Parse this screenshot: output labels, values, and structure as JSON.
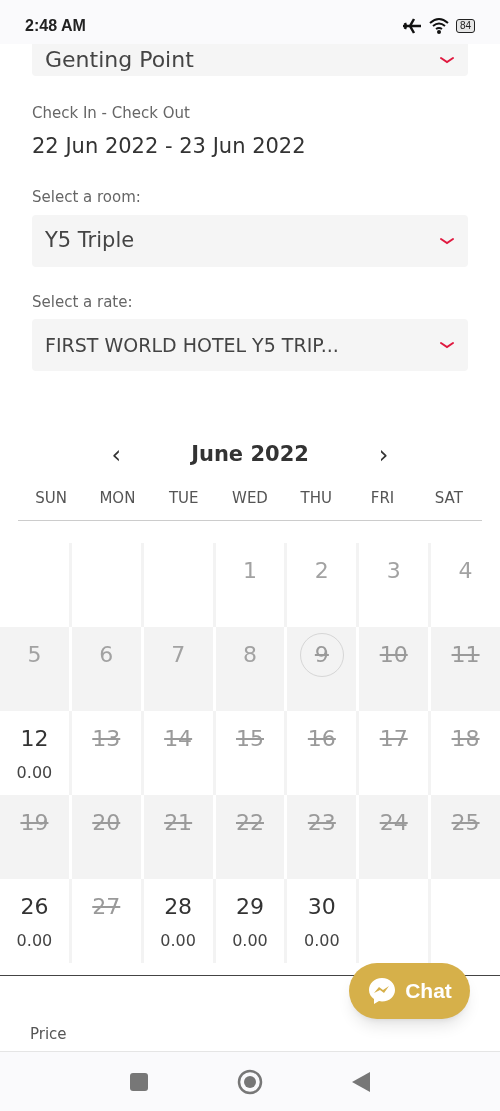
{
  "status_bar": {
    "time": "2:48 AM",
    "battery": "84"
  },
  "property_select": {
    "value": "Genting Point"
  },
  "dates": {
    "label": "Check In - Check Out",
    "value": "22 Jun 2022 - 23 Jun 2022"
  },
  "room": {
    "label": "Select a room:",
    "value": "Y5 Triple"
  },
  "rate": {
    "label": "Select a rate:",
    "value": "FIRST WORLD HOTEL Y5 TRIP..."
  },
  "calendar": {
    "prev": "‹",
    "month": "June 2022",
    "next": "›",
    "weekdays": [
      "SUN",
      "MON",
      "TUE",
      "WED",
      "THU",
      "FRI",
      "SAT"
    ],
    "weeks": [
      {
        "shaded": false,
        "days": [
          {
            "kind": "empty"
          },
          {
            "kind": "empty"
          },
          {
            "kind": "empty"
          },
          {
            "kind": "past",
            "day": "1"
          },
          {
            "kind": "past",
            "day": "2"
          },
          {
            "kind": "past",
            "day": "3"
          },
          {
            "kind": "past",
            "day": "4"
          }
        ]
      },
      {
        "shaded": true,
        "days": [
          {
            "kind": "past",
            "day": "5"
          },
          {
            "kind": "past",
            "day": "6"
          },
          {
            "kind": "past",
            "day": "7"
          },
          {
            "kind": "past",
            "day": "8"
          },
          {
            "kind": "unavailable",
            "day": "9",
            "today": true
          },
          {
            "kind": "unavailable",
            "day": "10"
          },
          {
            "kind": "unavailable",
            "day": "11"
          }
        ]
      },
      {
        "shaded": false,
        "days": [
          {
            "kind": "available",
            "day": "12",
            "price": "0.00"
          },
          {
            "kind": "unavailable",
            "day": "13"
          },
          {
            "kind": "unavailable",
            "day": "14"
          },
          {
            "kind": "unavailable",
            "day": "15"
          },
          {
            "kind": "unavailable",
            "day": "16"
          },
          {
            "kind": "unavailable",
            "day": "17"
          },
          {
            "kind": "unavailable",
            "day": "18"
          }
        ]
      },
      {
        "shaded": true,
        "days": [
          {
            "kind": "unavailable",
            "day": "19"
          },
          {
            "kind": "unavailable",
            "day": "20"
          },
          {
            "kind": "unavailable",
            "day": "21"
          },
          {
            "kind": "unavailable",
            "day": "22"
          },
          {
            "kind": "unavailable",
            "day": "23"
          },
          {
            "kind": "unavailable",
            "day": "24"
          },
          {
            "kind": "unavailable",
            "day": "25"
          }
        ]
      },
      {
        "shaded": false,
        "days": [
          {
            "kind": "available",
            "day": "26",
            "price": "0.00"
          },
          {
            "kind": "unavailable",
            "day": "27"
          },
          {
            "kind": "available",
            "day": "28",
            "price": "0.00"
          },
          {
            "kind": "available",
            "day": "29",
            "price": "0.00"
          },
          {
            "kind": "available",
            "day": "30",
            "price": "0.00"
          },
          {
            "kind": "empty"
          },
          {
            "kind": "empty"
          }
        ]
      }
    ]
  },
  "price_label": "Price",
  "chat_button": {
    "label": "Chat"
  }
}
